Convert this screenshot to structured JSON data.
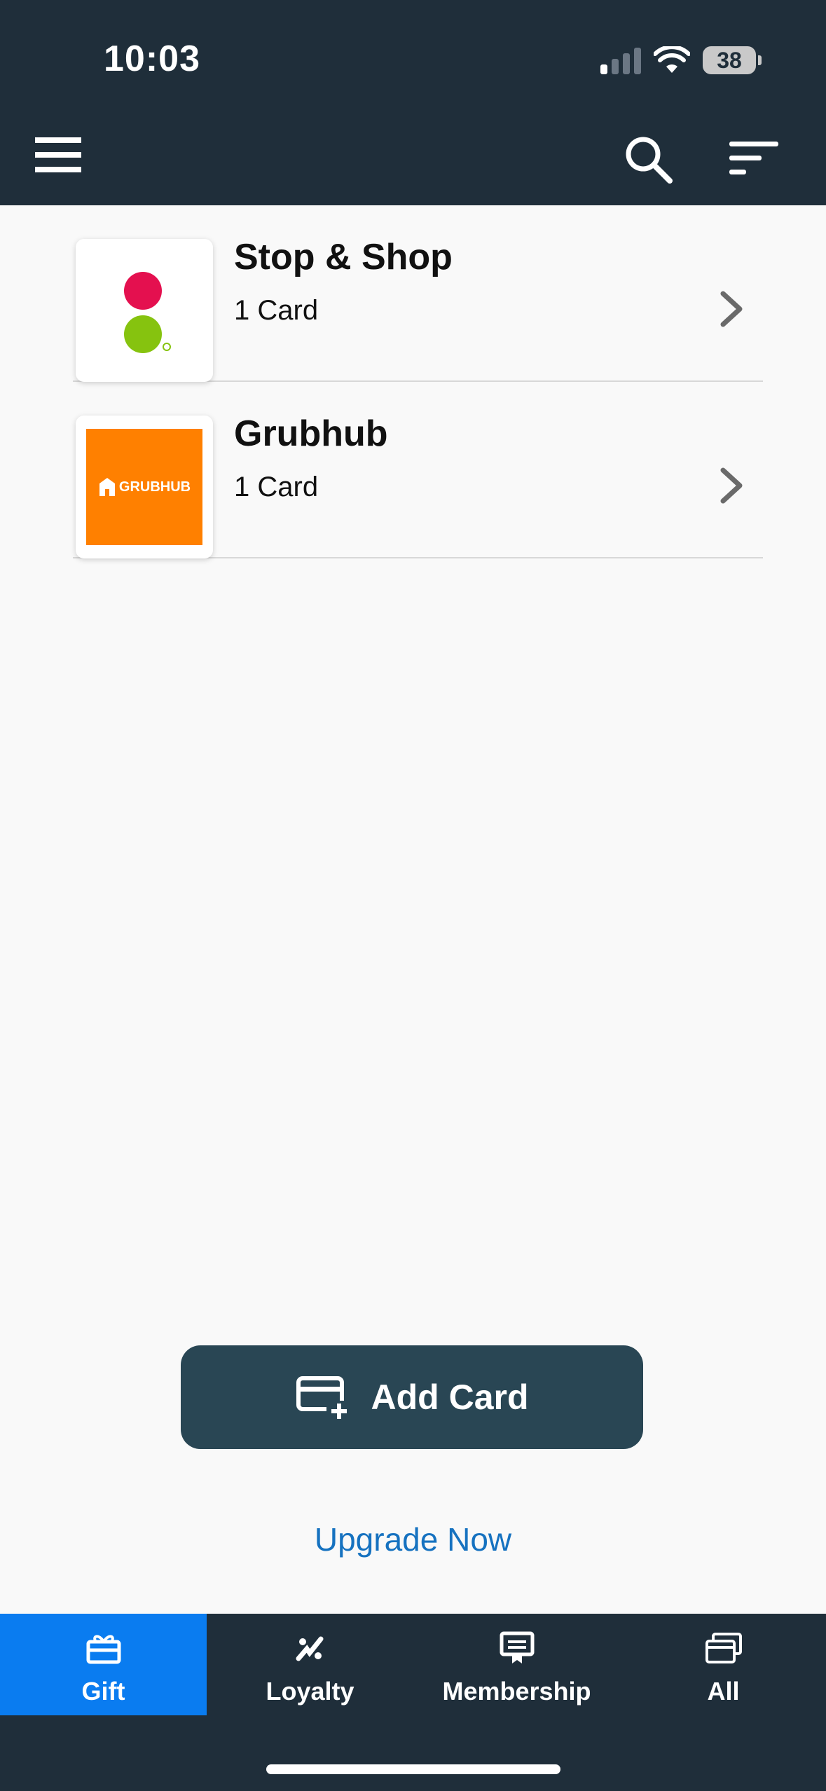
{
  "status_bar": {
    "time": "10:03",
    "battery": "38"
  },
  "header": {
    "menu_icon": "hamburger-menu-icon",
    "search_icon": "search-icon",
    "sort_icon": "sort-icon"
  },
  "list": {
    "items": [
      {
        "title": "Stop & Shop",
        "subtitle": "1 Card",
        "logo": "stop-and-shop-logo"
      },
      {
        "title": "Grubhub",
        "subtitle": "1 Card",
        "logo": "grubhub-logo",
        "logo_text": "GRUBHUB"
      }
    ]
  },
  "actions": {
    "add_card_label": "Add Card",
    "upgrade_label": "Upgrade Now"
  },
  "tabs": [
    {
      "label": "Gift",
      "icon": "gift-icon",
      "active": true
    },
    {
      "label": "Loyalty",
      "icon": "loyalty-icon",
      "active": false
    },
    {
      "label": "Membership",
      "icon": "membership-icon",
      "active": false
    },
    {
      "label": "All",
      "icon": "all-cards-icon",
      "active": false
    }
  ],
  "colors": {
    "header_bg": "#1f2e3a",
    "accent": "#0a7cf0",
    "button_bg": "#294654",
    "link": "#1672c0",
    "grubhub_orange": "#ff8000"
  }
}
